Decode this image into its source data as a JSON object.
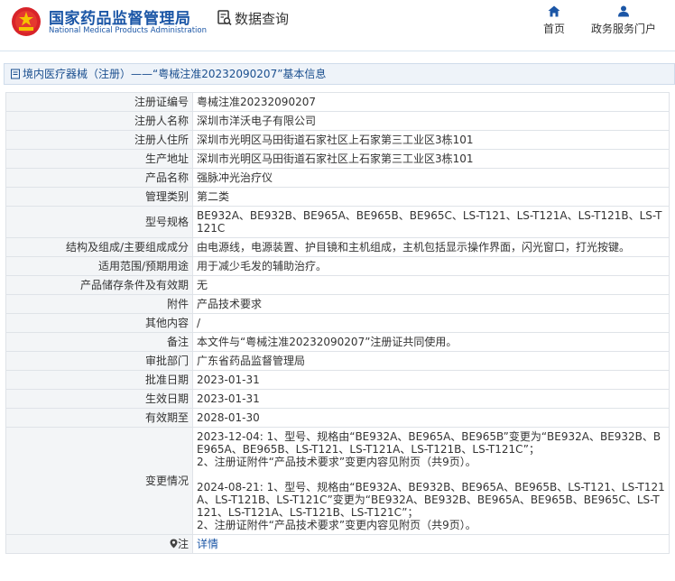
{
  "header": {
    "org_cn": "国家药品监督管理局",
    "org_en": "National Medical Products Administration",
    "system_title": "数据查询",
    "nav": {
      "home": "首页",
      "gov_services": "政务服务门户"
    }
  },
  "breadcrumb": "境内医疗器械（注册）——“粤械注准20232090207”基本信息",
  "colors": {
    "brand": "#1b56a6",
    "label_bg": "#f3f5f7",
    "border": "#dfe3e8"
  },
  "rows": [
    {
      "label": "注册证编号",
      "value": "粤械注准20232090207"
    },
    {
      "label": "注册人名称",
      "value": "深圳市洋沃电子有限公司"
    },
    {
      "label": "注册人住所",
      "value": "深圳市光明区马田街道石家社区上石家第三工业区3栋101"
    },
    {
      "label": "生产地址",
      "value": "深圳市光明区马田街道石家社区上石家第三工业区3栋101"
    },
    {
      "label": "产品名称",
      "value": "强脉冲光治疗仪"
    },
    {
      "label": "管理类别",
      "value": "第二类"
    },
    {
      "label": "型号规格",
      "value": "BE932A、BE932B、BE965A、BE965B、BE965C、LS-T121、LS-T121A、LS-T121B、LS-T121C"
    },
    {
      "label": "结构及组成/主要组成成分",
      "value": "由电源线，电源装置、护目镜和主机组成，主机包括显示操作界面，闪光窗口，打光按键。"
    },
    {
      "label": "适用范围/预期用途",
      "value": "用于减少毛发的辅助治疗。"
    },
    {
      "label": "产品储存条件及有效期",
      "value": "无"
    },
    {
      "label": "附件",
      "value": "产品技术要求"
    },
    {
      "label": "其他内容",
      "value": "/"
    },
    {
      "label": "备注",
      "value": "本文件与“粤械注准20232090207”注册证共同使用。"
    },
    {
      "label": "审批部门",
      "value": "广东省药品监督管理局"
    },
    {
      "label": "批准日期",
      "value": "2023-01-31"
    },
    {
      "label": "生效日期",
      "value": "2023-01-31"
    },
    {
      "label": "有效期至",
      "value": "2028-01-30"
    }
  ],
  "change": {
    "label": "变更情况",
    "lines": [
      "2023-12-04: 1、型号、规格由“BE932A、BE965A、BE965B”变更为“BE932A、BE932B、BE965A、BE965B、LS-T121、LS-T121A、LS-T121B、LS-T121C”；",
      "2、注册证附件“产品技术要求”变更内容见附页（共9页）。",
      "",
      "2024-08-21: 1、型号、规格由“BE932A、BE932B、BE965A、BE965B、LS-T121、LS-T121A、LS-T121B、LS-T121C”变更为“BE932A、BE932B、BE965A、BE965B、BE965C、LS-T121、LS-T121A、LS-T121B、LS-T121C”；",
      "2、注册证附件“产品技术要求”变更内容见附页（共9页）。"
    ]
  },
  "note": {
    "label": "注",
    "link": "详情"
  }
}
